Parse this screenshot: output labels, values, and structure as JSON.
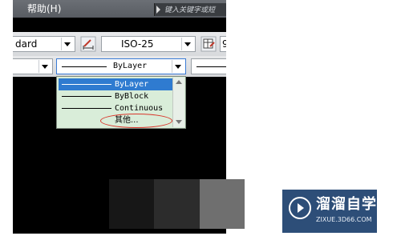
{
  "menubar": {
    "help_label": "帮助(H)"
  },
  "search": {
    "placeholder": "键入关键字或短"
  },
  "toolbar": {
    "style_combo_value": "dard",
    "dimstyle_combo_value": "ISO-25"
  },
  "linetype": {
    "current_value": "ByLayer",
    "options": [
      "ByLayer",
      "ByBlock",
      "Continuous",
      "其他..."
    ]
  },
  "logo": {
    "name": "溜溜自学",
    "url_text": "ZIXUE.3D66.COM"
  },
  "colors": {
    "selection": "#2f7bd0",
    "dropdown_bg": "#d9edd9",
    "annotation": "#d9362b",
    "logo_bg": "#2d4e78"
  }
}
